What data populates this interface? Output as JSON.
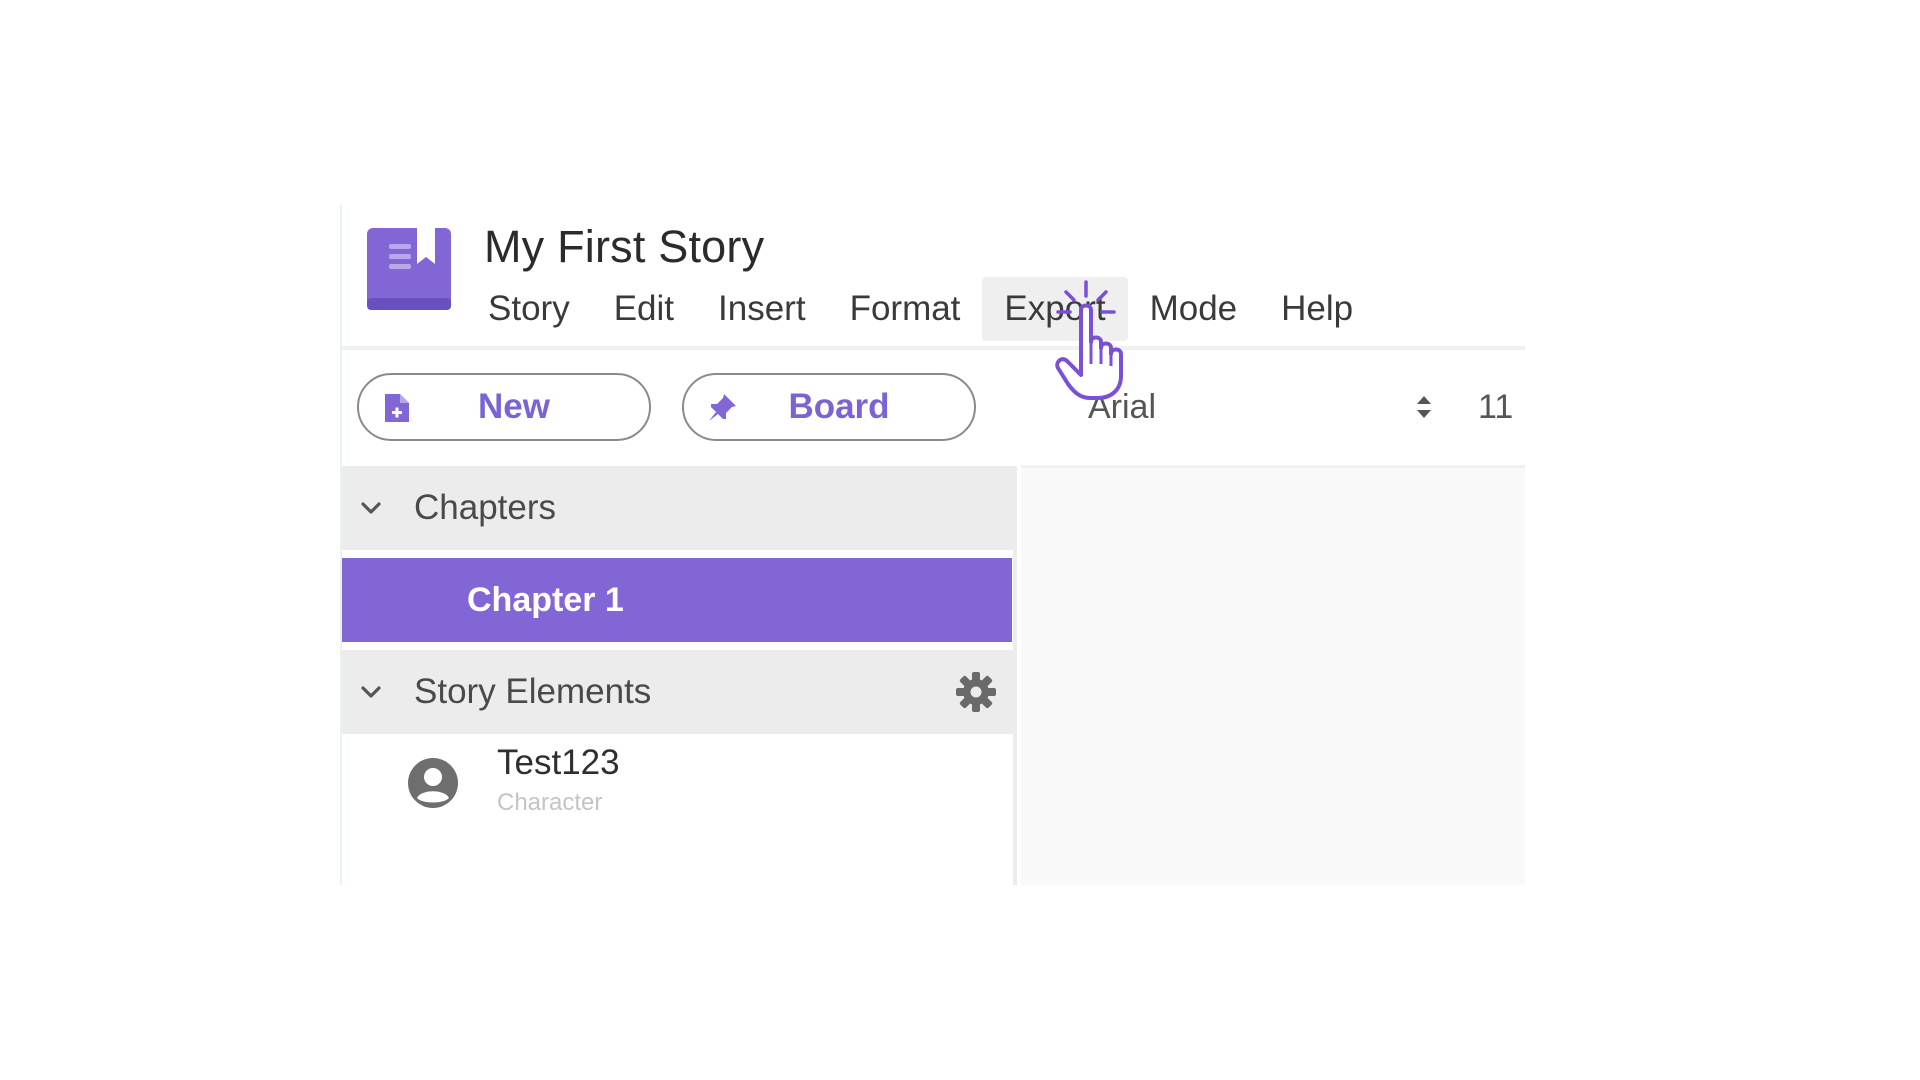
{
  "app": {
    "doc_title": "My First Story",
    "logo_icon": "book-bookmark-icon",
    "accent_color": "#8266d6"
  },
  "menu": {
    "items": [
      {
        "label": "Story"
      },
      {
        "label": "Edit"
      },
      {
        "label": "Insert"
      },
      {
        "label": "Format"
      },
      {
        "label": "Export",
        "active": true
      },
      {
        "label": "Mode"
      },
      {
        "label": "Help"
      }
    ]
  },
  "sidebar": {
    "new_button": {
      "label": "New",
      "icon": "new-document-icon"
    },
    "board_button": {
      "label": "Board",
      "icon": "pin-icon"
    },
    "chapters_section": {
      "title": "Chapters",
      "icon": "chevron-down-icon"
    },
    "chapters": [
      {
        "title": "Chapter 1",
        "selected": true
      }
    ],
    "elements_section": {
      "title": "Story Elements",
      "icon": "chevron-down-icon",
      "settings_icon": "gear-icon"
    },
    "elements": [
      {
        "name": "Test123",
        "type": "Character",
        "icon": "person-avatar-icon"
      }
    ]
  },
  "editor": {
    "font_family": "Arial",
    "font_size": "11"
  },
  "cursor": {
    "icon": "hand-pointer-icon",
    "color": "#7b4fd6"
  }
}
